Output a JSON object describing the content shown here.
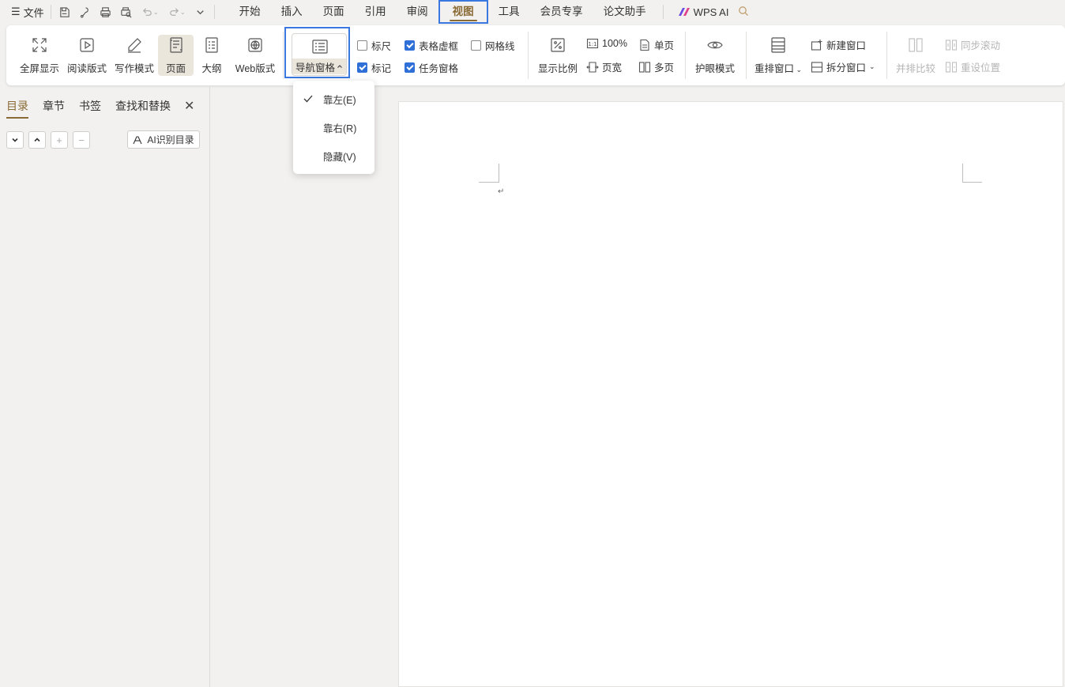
{
  "topbar": {
    "file_label": "文件",
    "tabs": [
      "开始",
      "插入",
      "页面",
      "引用",
      "审阅",
      "视图",
      "工具",
      "会员专享",
      "论文助手"
    ],
    "active_tab": "视图",
    "wps_ai_label": "WPS AI"
  },
  "ribbon": {
    "fullscreen": "全屏显示",
    "reading": "阅读版式",
    "writing": "写作模式",
    "page": "页面",
    "outline": "大纲",
    "web": "Web版式",
    "nav_pane": "导航窗格",
    "ruler": "标尺",
    "table_gridlines": "表格虚框",
    "gridlines": "网格线",
    "marks": "标记",
    "task_pane": "任务窗格",
    "zoom": "显示比例",
    "zoom100": "100%",
    "page_width": "页宽",
    "single_page": "单页",
    "multi_page": "多页",
    "eye_care": "护眼模式",
    "rearrange": "重排窗口",
    "new_window": "新建窗口",
    "split_window": "拆分窗口",
    "side_by_side": "并排比较",
    "sync_scroll": "同步滚动",
    "reset_position": "重设位置"
  },
  "checkboxes": {
    "ruler": false,
    "table_gridlines": true,
    "gridlines": false,
    "marks": true,
    "task_pane": true
  },
  "dropdown": {
    "items": [
      "靠左(E)",
      "靠右(R)",
      "隐藏(V)"
    ],
    "checked_index": 0
  },
  "left_panel": {
    "tabs": [
      "目录",
      "章节",
      "书签",
      "查找和替换"
    ],
    "active_tab": "目录",
    "ai_button": "AI识别目录"
  },
  "document": {
    "paragraph_mark": "↵"
  },
  "colors": {
    "accent": "#8a6a35",
    "highlight": "#3a78e0",
    "checkbox": "#2f6fd8"
  }
}
